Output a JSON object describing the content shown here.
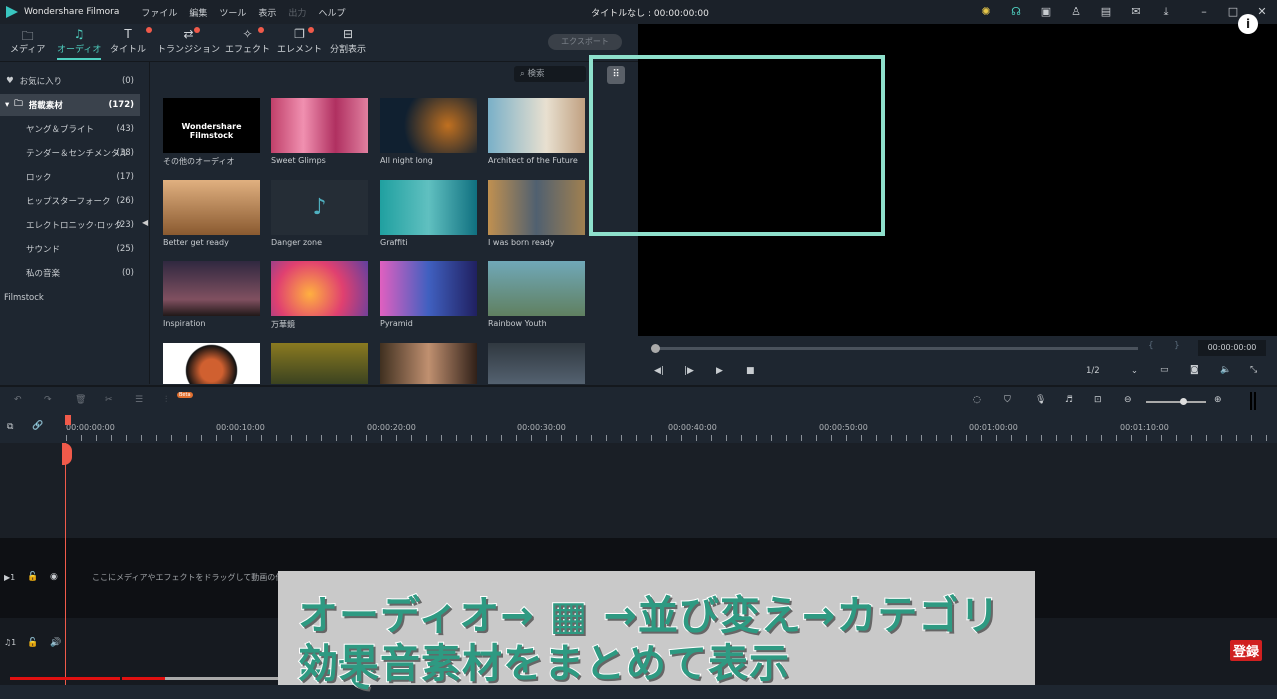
{
  "app": {
    "name": "Wondershare Filmora",
    "window_title": "タイトルなし : 00:00:00:00",
    "menu": [
      "ファイル",
      "編集",
      "ツール",
      "表示",
      "出力",
      "ヘルプ"
    ]
  },
  "tabs": [
    {
      "label": "メディア",
      "icon": "folder-icon"
    },
    {
      "label": "オーディオ",
      "icon": "music-icon",
      "active": true
    },
    {
      "label": "タイトル",
      "icon": "text-icon"
    },
    {
      "label": "トランジション",
      "icon": "transition-icon"
    },
    {
      "label": "エフェクト",
      "icon": "effect-icon"
    },
    {
      "label": "エレメント",
      "icon": "element-icon"
    },
    {
      "label": "分割表示",
      "icon": "split-icon"
    }
  ],
  "export_label": "エクスポート",
  "sidebar": {
    "items": [
      {
        "label": "お気に入り",
        "count": "(0)"
      },
      {
        "label": "搭載素材",
        "count": "(172)"
      },
      {
        "label": "ヤング＆ブライト",
        "count": "(43)"
      },
      {
        "label": "テンダー＆センチメンタル",
        "count": "(38)"
      },
      {
        "label": "ロック",
        "count": "(17)"
      },
      {
        "label": "ヒップスターフォーク",
        "count": "(26)"
      },
      {
        "label": "エレクトロニック·ロック",
        "count": "(23)"
      },
      {
        "label": "サウンド",
        "count": "(25)"
      },
      {
        "label": "私の音楽",
        "count": "(0)"
      }
    ],
    "filmstock": "Filmstock"
  },
  "search_placeholder": "検索",
  "filmstock_logo": "Wondershare Filmstock",
  "cards": [
    "その他のオーディオ",
    "Sweet Glimps",
    "All night long",
    "Architect of the Future",
    "Better get ready",
    "Danger zone",
    "Graffiti",
    "I was born ready",
    "Inspiration",
    "万華鏡",
    "Pyramid",
    "Rainbow Youth",
    "",
    "",
    "",
    ""
  ],
  "player": {
    "time": "00:00:00:00",
    "quality": "1/2"
  },
  "timeline": {
    "beta": "Beta",
    "ticks": [
      "00:00:00:00",
      "00:00:10:00",
      "00:00:20:00",
      "00:00:30:00",
      "00:00:40:00",
      "00:00:50:00",
      "00:01:00:00",
      "00:01:10:00"
    ],
    "drop_hint": "ここにメディアやエフェクトをドラッグして動画の作成を開始",
    "video_track": "1",
    "audio_track": "1"
  },
  "caption": {
    "line1": "オーディオ→ ▦ →並び変え→カテゴリーで",
    "line2": "効果音素材をまとめて表示"
  },
  "badge": "登録",
  "colors": {
    "accent": "#4fd0c0",
    "highlight": "#8ee0cc",
    "caption_text": "#2e9a82",
    "playhead": "#f05a4a"
  }
}
